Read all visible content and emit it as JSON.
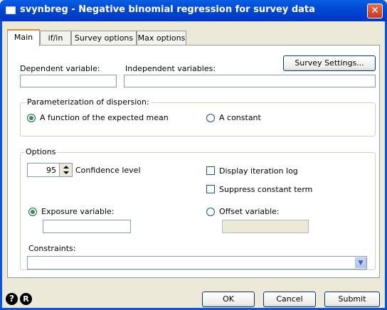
{
  "window": {
    "title": "svynbreg - Negative binomial regression for survey data",
    "close_symbol": "✕"
  },
  "tabs": [
    {
      "label": "Main",
      "active": true
    },
    {
      "label": "if/in",
      "active": false
    },
    {
      "label": "Survey options",
      "active": false
    },
    {
      "label": "Max options",
      "active": false
    }
  ],
  "main": {
    "survey_settings_label": "Survey Settings...",
    "dependent_label": "Dependent variable:",
    "dependent_value": "",
    "independent_label": "Independent variables:",
    "independent_value": "",
    "dispersion": {
      "title": "Parameterization of dispersion:",
      "option_mean": "A function of the expected mean",
      "option_constant": "A constant",
      "selected": "mean"
    },
    "options": {
      "title": "Options",
      "confidence_value": "95",
      "confidence_label": "Confidence level",
      "display_iteration_log": "Display iteration log",
      "suppress_constant": "Suppress constant term",
      "exposure_label": "Exposure variable:",
      "exposure_value": "",
      "offset_label": "Offset variable:",
      "offset_value": "",
      "exposure_selected": true
    },
    "constraints_label": "Constraints:",
    "constraints_value": ""
  },
  "footer": {
    "help_symbol": "?",
    "reset_symbol": "R",
    "ok_label": "OK",
    "cancel_label": "Cancel",
    "submit_label": "Submit"
  }
}
